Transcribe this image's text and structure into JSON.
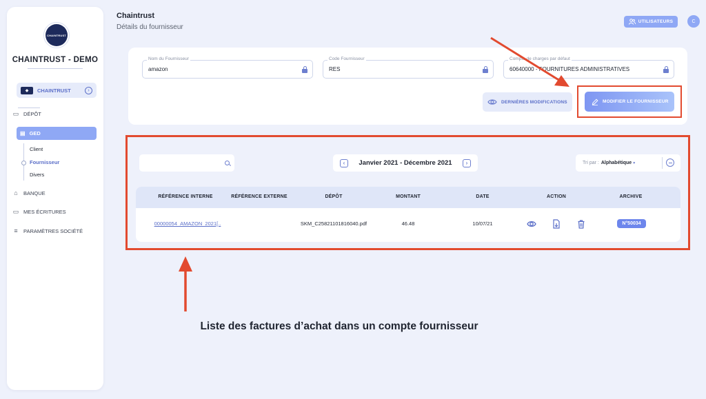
{
  "sidebar": {
    "logo_text": "CHAINTRUST",
    "company_name": "CHAINTRUST - DEMO",
    "org_selector": {
      "chip": "◆",
      "label": "CHAINTRUST"
    },
    "nav": {
      "depot": "DÉPÔT",
      "ged": "GED",
      "ged_sub": {
        "client": "Client",
        "fournisseur": "Fournisseur",
        "divers": "Divers"
      },
      "banque": "BANQUE",
      "ecritures": "MES ÉCRITURES",
      "parametres": "PARAMÈTRES SOCIÉTÉ"
    }
  },
  "header": {
    "title": "Chaintrust",
    "subtitle": "Détails du fournisseur",
    "users_button": "UTILISATEURS",
    "avatar_initial": "C"
  },
  "supplier_form": {
    "name": {
      "label": "Nom du Fournisseur",
      "value": "amazon"
    },
    "code": {
      "label": "Code Fournisseur",
      "value": "RES"
    },
    "account": {
      "label": "Compte de charges par défaut",
      "value": "60640000 - FOURNITURES ADMINISTRATIVES"
    },
    "history_button": "DERNIÈRES MODIFICATIONS",
    "edit_button": "MODIFIER LE FOURNISSEUR"
  },
  "invoices": {
    "search_placeholder": "",
    "period": "Janvier 2021 - Décembre 2021",
    "sort_prefix": "Tri par :",
    "sort_value": "Alphabétique",
    "columns": [
      "RÉFÉRENCE INTERNE",
      "RÉFÉRENCE EXTERNE",
      "DÉPÔT",
      "MONTANT",
      "DATE",
      "ACTION",
      "ARCHIVE"
    ],
    "rows": [
      {
        "internal_ref": "00000054_AMAZON_2021[..",
        "external_ref": "",
        "depot": "SKM_C25821101816040.pdf",
        "amount": "46.48",
        "date": "10/07/21",
        "archive": "N°50034"
      }
    ]
  },
  "annotation": {
    "caption": "Liste des factures d’achat dans un compte fournisseur",
    "highlight_color": "#e24a2f"
  },
  "colors": {
    "accent": "#8fa8f5",
    "accent_dark": "#5a6ec8",
    "background": "#eef1fb",
    "table_header": "#dfe6f8"
  }
}
